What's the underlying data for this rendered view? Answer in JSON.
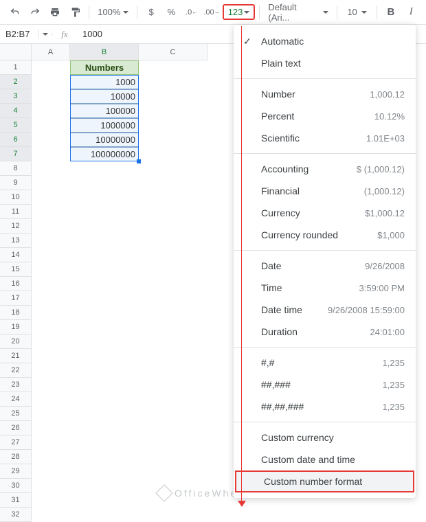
{
  "toolbar": {
    "zoom": "100%",
    "format_123": "123",
    "font_name": "Default (Ari...",
    "font_size": "10"
  },
  "namebox": {
    "ref": "B2:B7",
    "fx": "fx",
    "formula": "1000"
  },
  "columns": [
    "A",
    "B",
    "C"
  ],
  "rows": [
    "1",
    "2",
    "3",
    "4",
    "5",
    "6",
    "7",
    "8",
    "9",
    "10",
    "11",
    "12",
    "13",
    "14",
    "15",
    "16",
    "17",
    "18",
    "19",
    "20",
    "21",
    "22",
    "23",
    "24",
    "25",
    "26",
    "27",
    "28",
    "29",
    "30",
    "31",
    "32"
  ],
  "sheet": {
    "b1": "Numbers",
    "b2": "1000",
    "b3": "10000",
    "b4": "100000",
    "b5": "1000000",
    "b6": "10000000",
    "b7": "100000000"
  },
  "menu": {
    "automatic": "Automatic",
    "plaintext": "Plain text",
    "number": {
      "label": "Number",
      "ex": "1,000.12"
    },
    "percent": {
      "label": "Percent",
      "ex": "10.12%"
    },
    "scientific": {
      "label": "Scientific",
      "ex": "1.01E+03"
    },
    "accounting": {
      "label": "Accounting",
      "ex": "$ (1,000.12)"
    },
    "financial": {
      "label": "Financial",
      "ex": "(1,000.12)"
    },
    "currency": {
      "label": "Currency",
      "ex": "$1,000.12"
    },
    "currency_rounded": {
      "label": "Currency rounded",
      "ex": "$1,000"
    },
    "date": {
      "label": "Date",
      "ex": "9/26/2008"
    },
    "time": {
      "label": "Time",
      "ex": "3:59:00 PM"
    },
    "datetime": {
      "label": "Date time",
      "ex": "9/26/2008 15:59:00"
    },
    "duration": {
      "label": "Duration",
      "ex": "24:01:00"
    },
    "p1": {
      "label": "#,#",
      "ex": "1,235"
    },
    "p2": {
      "label": "##,###",
      "ex": "1,235"
    },
    "p3": {
      "label": "##,##,###",
      "ex": "1,235"
    },
    "custom_currency": "Custom currency",
    "custom_datetime": "Custom date and time",
    "custom_number": "Custom number format"
  },
  "watermark": "OfficeWheel"
}
